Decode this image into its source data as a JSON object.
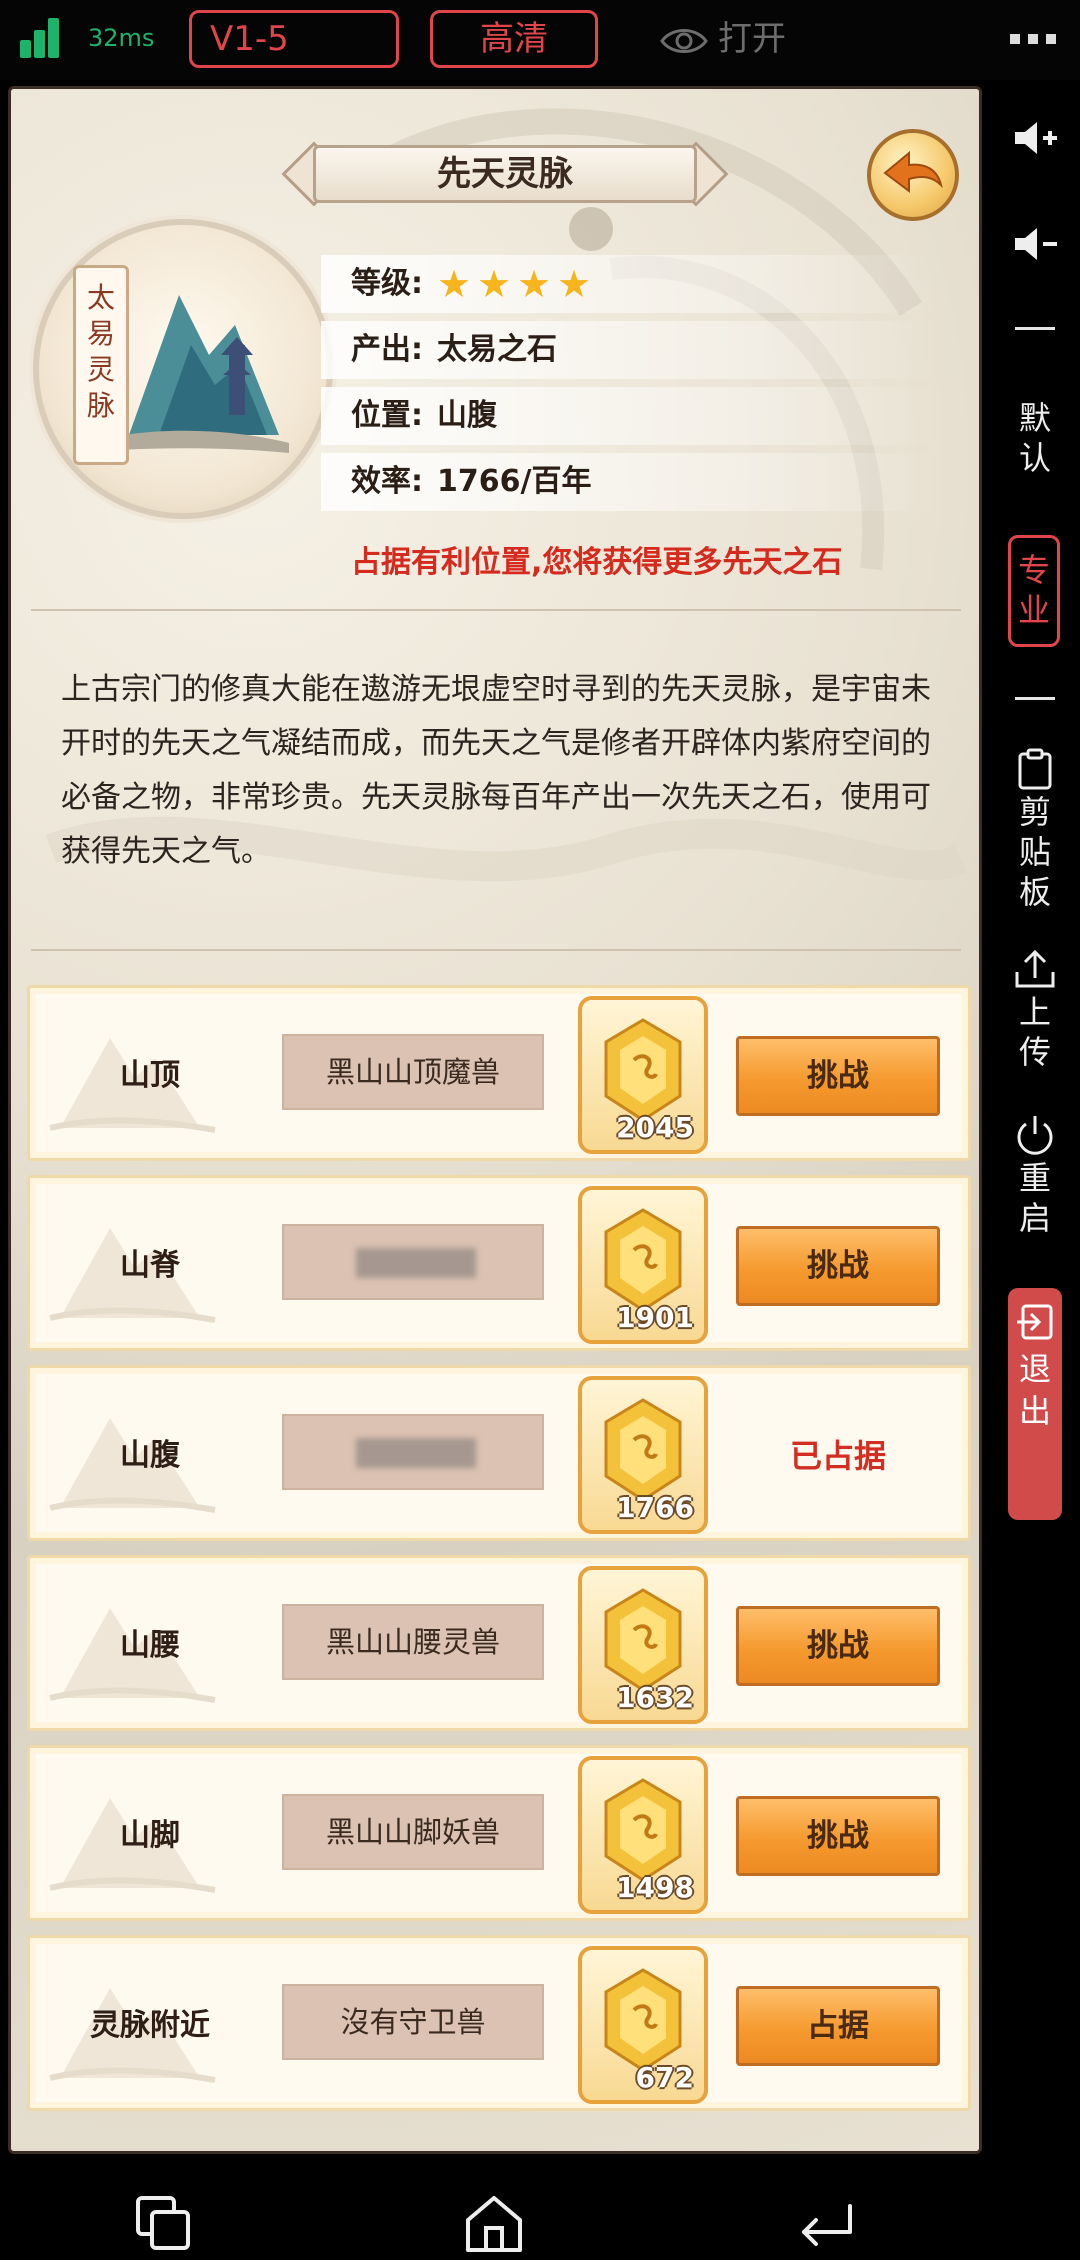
{
  "topbar": {
    "latency": "32ms",
    "version": "V1-5",
    "quality": "高清",
    "eye_toggle": "打开"
  },
  "sidebar": {
    "default_label": "默认",
    "pro_label": "专业",
    "clipboard_label": "剪贴板",
    "upload_label": "上传",
    "restart_label": "重启",
    "exit_label": "退出"
  },
  "game": {
    "title": "先天灵脉",
    "emblem_tag": "太易灵脉",
    "info": {
      "level_label": "等级:",
      "level_stars": 4,
      "output_label": "产出:",
      "output_value": "太易之石",
      "position_label": "位置:",
      "position_value": "山腹",
      "efficiency_label": "效率:",
      "efficiency_value": "1766/百年"
    },
    "tip": "占据有利位置,您将获得更多先天之石",
    "description": "上古宗门的修真大能在遨游无垠虚空时寻到的先天灵脉，是宇宙未开时的先天之气凝结而成，而先天之气是修者开辟体内紫府空间的必备之物，非常珍贵。先天灵脉每百年产出一次先天之石，使用可获得先天之气。",
    "locations": [
      {
        "name": "山顶",
        "guard": "黑山山顶魔兽",
        "guard_blurred": false,
        "count": "2045",
        "action": "挑战",
        "occupied": false
      },
      {
        "name": "山脊",
        "guard": "",
        "guard_blurred": true,
        "count": "1901",
        "action": "挑战",
        "occupied": false
      },
      {
        "name": "山腹",
        "guard": "",
        "guard_blurred": true,
        "count": "1766",
        "action": "已占据",
        "occupied": true
      },
      {
        "name": "山腰",
        "guard": "黑山山腰灵兽",
        "guard_blurred": false,
        "count": "1632",
        "action": "挑战",
        "occupied": false
      },
      {
        "name": "山脚",
        "guard": "黑山山脚妖兽",
        "guard_blurred": false,
        "count": "1498",
        "action": "挑战",
        "occupied": false
      },
      {
        "name": "灵脉附近",
        "guard": "沒有守卫兽",
        "guard_blurred": false,
        "count": "672",
        "action": "占据",
        "occupied": false
      }
    ]
  },
  "colors": {
    "accent_green": "#1db36b",
    "accent_red": "#e0454a",
    "button_orange": "#f59a2f",
    "tip_red": "#d52a1e"
  }
}
